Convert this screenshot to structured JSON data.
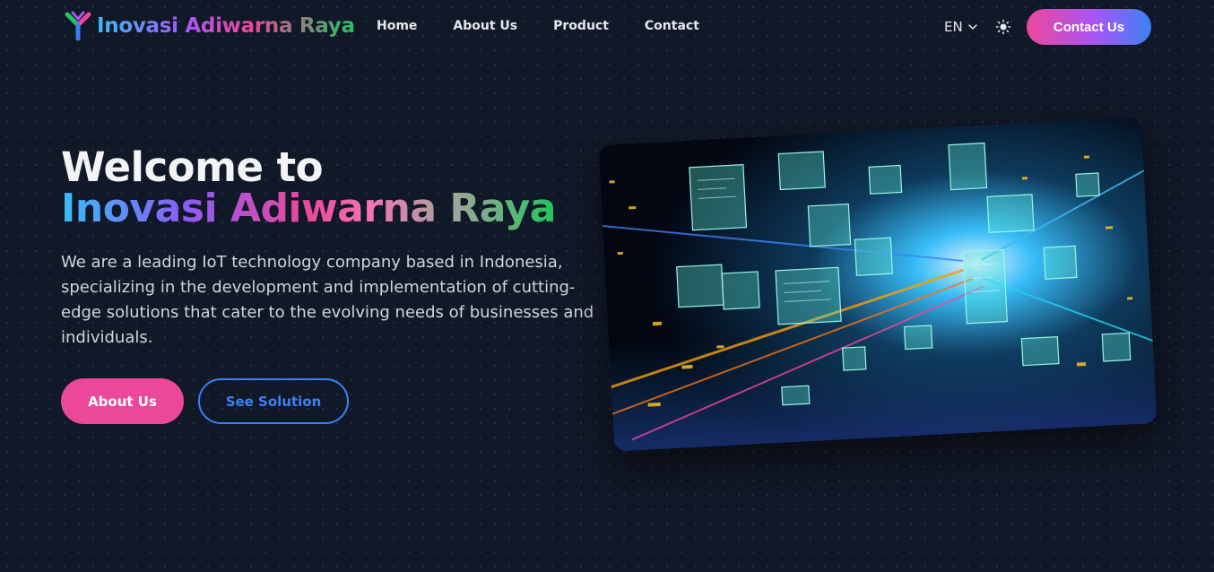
{
  "brand": {
    "name": "Inovasi Adiwarna Raya",
    "logo_icon": "y-shaped-logo-icon"
  },
  "nav": {
    "items": [
      {
        "label": "Home"
      },
      {
        "label": "About Us"
      },
      {
        "label": "Product"
      },
      {
        "label": "Contact"
      }
    ],
    "language": "EN",
    "language_icon": "chevron-down-icon",
    "theme_icon": "sun-icon",
    "cta_label": "Contact Us"
  },
  "hero": {
    "title_line1": "Welcome to",
    "title_line2": "Inovasi Adiwarna Raya",
    "description": "We are a leading IoT technology company based in Indonesia, specializing in the development and implementation of cutting-edge solutions that cater to the evolving needs of businesses and individuals.",
    "primary_button": "About Us",
    "secondary_button": "See Solution",
    "image_subject": "futuristic data center corridor with floating holographic screens"
  },
  "colors": {
    "background": "#111827",
    "pink": "#ec4899",
    "blue": "#3b82f6",
    "purple": "#a855f7",
    "green": "#22c55e"
  }
}
